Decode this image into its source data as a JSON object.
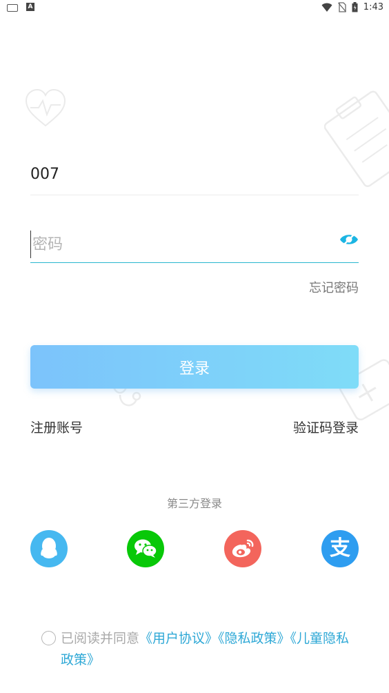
{
  "status_bar": {
    "time": "1:43",
    "left_icons": [
      "keyboard-icon",
      "a-icon"
    ],
    "right_icons": [
      "wifi-icon",
      "no-sim-icon",
      "battery-icon"
    ]
  },
  "login_form": {
    "account_value": "007",
    "password_placeholder": "密码",
    "forgot_password": "忘记密码",
    "login_button": "登录",
    "register_link": "注册账号",
    "sms_login_link": "验证码登录"
  },
  "third_party": {
    "title": "第三方登录",
    "providers": [
      "qq",
      "wechat",
      "weibo",
      "alipay"
    ],
    "alipay_glyph": "支"
  },
  "agreement": {
    "prefix": "已阅读并同意",
    "user_agreement": "《用户协议》",
    "privacy_policy": "《隐私政策》",
    "children_privacy": "《儿童隐私政策》"
  },
  "colors": {
    "accent": "#27b6cf",
    "link": "#2ea8d6",
    "button_gradient_start": "#7cc3fb",
    "button_gradient_end": "#7fdcf8",
    "qq": "#46b8f0",
    "wechat": "#08c808",
    "weibo": "#f3655c",
    "alipay": "#2e9df0"
  }
}
